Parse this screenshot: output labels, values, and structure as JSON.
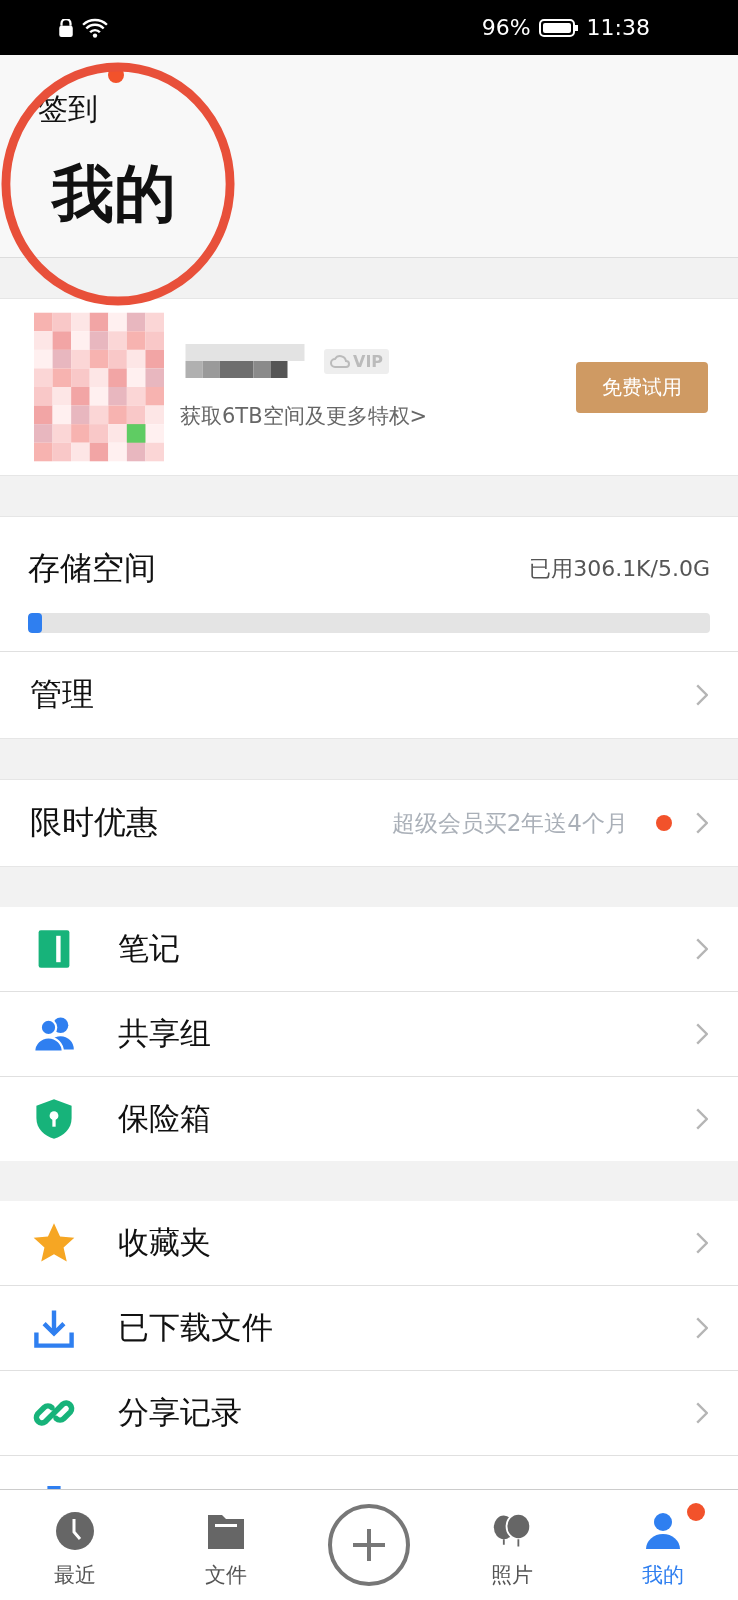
{
  "status_bar": {
    "battery": "96%",
    "time": "11:38"
  },
  "header": {
    "checkin": "签到",
    "checkin_badge": true,
    "title": "我的"
  },
  "profile": {
    "vip": "VIP",
    "promo": "获取6TB空间及更多特权>",
    "trial_button": "免费试用"
  },
  "storage": {
    "title": "存储空间",
    "usage": "已用306.1K/5.0G",
    "level": 0.02,
    "manage": "管理"
  },
  "offer": {
    "title": "限时优惠",
    "note": "超级会员买2年送4个月",
    "badge": true
  },
  "sections": [
    [
      {
        "label": "笔记"
      },
      {
        "label": "共享组"
      },
      {
        "label": "保险箱"
      }
    ],
    [
      {
        "label": "收藏夹"
      },
      {
        "label": "已下载文件"
      },
      {
        "label": "分享记录"
      }
    ]
  ],
  "bottom_nav": [
    {
      "label": "最近",
      "selected": false,
      "badge": false
    },
    {
      "label": "文件",
      "selected": false,
      "badge": false
    },
    {
      "kind": "add"
    },
    {
      "label": "照片",
      "selected": false,
      "badge": false
    },
    {
      "label": "我的",
      "selected": true,
      "badge": true
    }
  ]
}
